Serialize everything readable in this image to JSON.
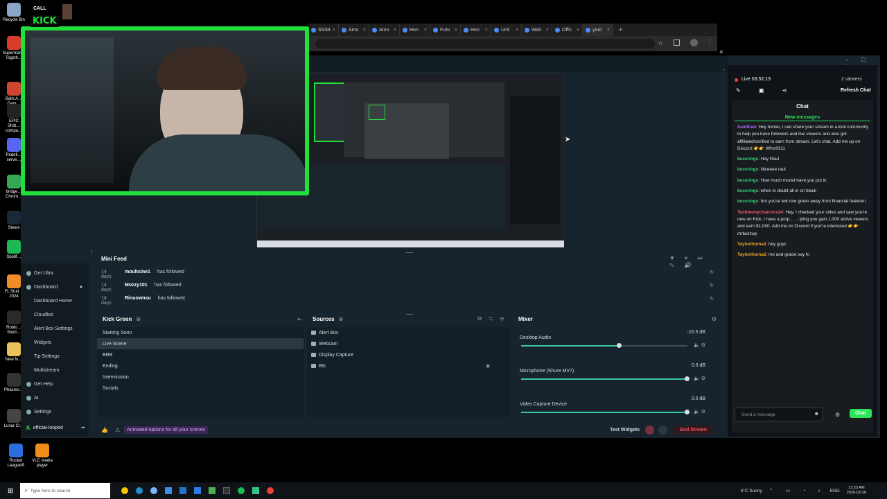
{
  "desktop": {
    "icons": [
      {
        "label": "Recycle Bin",
        "color": "#8aa5c8"
      },
      {
        "label": "Supermar… Togeth…",
        "color": "#d63b2c"
      },
      {
        "label": "Balls A… Gam…",
        "color": "#d1452f"
      },
      {
        "label": "EPIC Shitt… compa…",
        "color": "#222222"
      },
      {
        "label": "Pedofi… serve…",
        "color": "#5865f2"
      },
      {
        "label": "bridge… Chrom…",
        "color": "#34a853"
      },
      {
        "label": "Steam",
        "color": "#1b2838"
      },
      {
        "label": "Spotif…",
        "color": "#1db954"
      },
      {
        "label": "FL Stud… 2024",
        "color": "#f28c28"
      },
      {
        "label": "Roblo… Studi…",
        "color": "#2a2a2a"
      },
      {
        "label": "New fo…",
        "color": "#e8c25a"
      },
      {
        "label": "Phasmo…",
        "color": "#333333"
      },
      {
        "label": "Lunar Cl…",
        "color": "#444444"
      }
    ],
    "bottom_icons": [
      {
        "label": "Rocket League®",
        "color": "#2a6fdb"
      },
      {
        "label": "VLC media player",
        "color": "#f08c1a"
      }
    ]
  },
  "overlay": {
    "kick_logo": "KICK",
    "top_tag": "CALL"
  },
  "browser": {
    "tabs": [
      {
        "label": "SSS4",
        "active": false
      },
      {
        "label": "Amo",
        "active": false
      },
      {
        "label": "Amo",
        "active": false
      },
      {
        "label": "Hon",
        "active": false
      },
      {
        "label": "Futu",
        "active": false
      },
      {
        "label": "Hon",
        "active": false
      },
      {
        "label": "Unti",
        "active": false
      },
      {
        "label": "Wait",
        "active": false
      },
      {
        "label": "Offic",
        "active": false
      },
      {
        "label": "yout",
        "active": true
      }
    ],
    "new_tab": "+"
  },
  "sidebar": {
    "items": [
      {
        "label": "Get Ultra",
        "icon": "star-icon",
        "sub": false
      },
      {
        "label": "Dashboard",
        "icon": "dashboard-icon",
        "sub": false,
        "chevron": "▲"
      },
      {
        "label": "Dashboard Home",
        "icon": "",
        "sub": true
      },
      {
        "label": "Cloudbot",
        "icon": "",
        "sub": true
      },
      {
        "label": "Alert Box Settings",
        "icon": "",
        "sub": true
      },
      {
        "label": "Widgets",
        "icon": "",
        "sub": true
      },
      {
        "label": "Tip Settings",
        "icon": "",
        "sub": true
      },
      {
        "label": "Multistream",
        "icon": "",
        "sub": true
      },
      {
        "label": "Get Help",
        "icon": "help-icon",
        "sub": false
      },
      {
        "label": "AI",
        "icon": "ai-icon",
        "sub": false
      },
      {
        "label": "Settings",
        "icon": "gear-icon",
        "sub": false
      }
    ],
    "account": "official-looped"
  },
  "mini_feed": {
    "title": "Mini Feed",
    "rows": [
      {
        "age": "14 days",
        "user": "mouhsine1",
        "action": "has followed"
      },
      {
        "age": "14 days",
        "user": "Mozzy101",
        "action": "has followed"
      },
      {
        "age": "14 days",
        "user": "Rinuownsu",
        "action": "has followed"
      }
    ]
  },
  "scenes": {
    "title": "Kick Green",
    "items": [
      {
        "label": "Starting Soon",
        "active": false
      },
      {
        "label": "Live Scene",
        "active": true
      },
      {
        "label": "BRB",
        "active": false
      },
      {
        "label": "Ending",
        "active": false
      },
      {
        "label": "Intermission",
        "active": false
      },
      {
        "label": "Socials",
        "active": false
      }
    ]
  },
  "sources": {
    "title": "Sources",
    "items": [
      {
        "label": "Alert Box",
        "icon": "alert-icon"
      },
      {
        "label": "Webcam",
        "icon": "folder-icon"
      },
      {
        "label": "Display Capture",
        "icon": "monitor-icon"
      },
      {
        "label": "BG",
        "icon": "image-icon"
      }
    ]
  },
  "mixer": {
    "title": "Mixer",
    "channels": [
      {
        "name": "Desktop Audio",
        "db": "-16.5 dB",
        "level": 0.59
      },
      {
        "name": "Microphone (Shure MV7)",
        "db": "0.0 dB",
        "level": 1.0
      },
      {
        "name": "Video Capture Device",
        "db": "0.0 dB",
        "level": 1.0
      }
    ]
  },
  "footer": {
    "promo": "Animated options for all your scenes",
    "test_widgets": "Test Widgets",
    "end_stream": "End Stream"
  },
  "chat": {
    "status": "Live 03:52:13",
    "viewers": "2 viewers",
    "refresh": "Refresh Chat",
    "title": "Chat",
    "new_messages": "New messages",
    "messages": [
      {
        "user": "Samthan",
        "color": "#b46bff",
        "text": "Hey homie, I can share your stream in a kick community to help you have followers and live viewers and also got affiliated/verified to earn from stream. Let's chat. Add me up on Discord 👉👉 Whiz0311"
      },
      {
        "user": "becerings",
        "color": "#37d67a",
        "text": "Hey Raul"
      },
      {
        "user": "becerings",
        "color": "#37d67a",
        "text": "Niceeee raul"
      },
      {
        "user": "becerings",
        "color": "#37d67a",
        "text": "How much monet have you put in"
      },
      {
        "user": "becerings",
        "color": "#37d67a",
        "text": "when in doubt all in on black"
      },
      {
        "user": "becerings",
        "color": "#37d67a",
        "text": "bro you're lwk one green away from financial freedom"
      },
      {
        "user": "Testimonycharrons34",
        "color": "#ff5a79",
        "text": "Hey, I checked your video and saw you're new on Kick. I have a prop… …lping you gain 1,000 active viewers and earn $1,000. Add me on Discord if you're interested 👉👉 mrbuzzup"
      },
      {
        "user": "Taylorthoma2",
        "color": "#f5a623",
        "text": "hey guys"
      },
      {
        "user": "Taylorthoma2",
        "color": "#f5a623",
        "text": "me and gracie say hi"
      }
    ],
    "input_placeholder": "Send a message",
    "send_label": "Chat"
  },
  "taskbar": {
    "search_placeholder": "Type here to search",
    "weather": "4°C  Sunny",
    "lang": "ENG",
    "time": "12:23 AM",
    "date": "2026-02-28"
  }
}
